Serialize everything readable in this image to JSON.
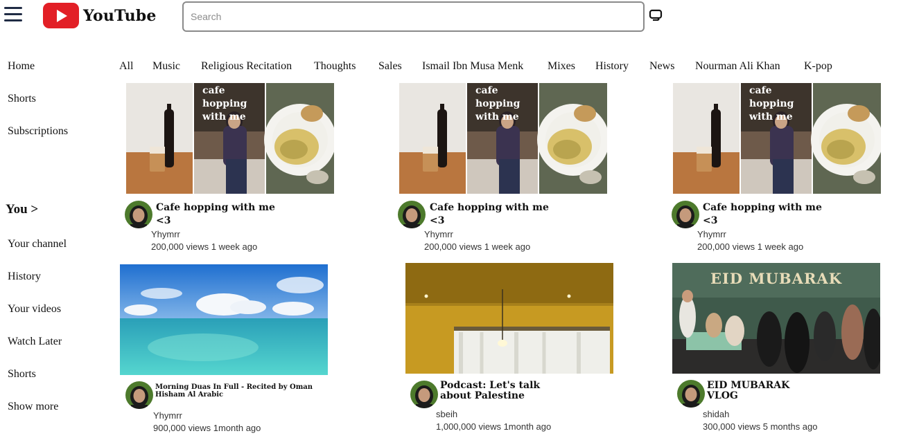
{
  "header": {
    "logo_text": "YouTube",
    "search_placeholder": "Search"
  },
  "sidebar": {
    "top": [
      "Home",
      "Shorts",
      "Subscriptions"
    ],
    "you_label": "You >",
    "you_items": [
      "Your channel",
      "History",
      "Your videos",
      "Watch Later",
      "Shorts",
      "Show more"
    ]
  },
  "chips": [
    "All",
    "Music",
    "Religious Recitation",
    "Thoughts",
    "Sales",
    "Ismail Ibn Musa Menk",
    "Mixes",
    "History",
    "News",
    "Nourman Ali Khan",
    "K-pop"
  ],
  "videos": [
    {
      "title": "Cafe hopping with me <3",
      "channel": "Yhymrr",
      "meta": "200,000 views 1 week ago",
      "thumb_text": "cafe hopping with me"
    },
    {
      "title": "Cafe hopping with me <3",
      "channel": "Yhymrr",
      "meta": "200,000 views 1 week ago",
      "thumb_text": "cafe hopping with me"
    },
    {
      "title": "Cafe hopping with me <3",
      "channel": "Yhymrr",
      "meta": "200,000 views 1 week ago",
      "thumb_text": "cafe hopping with me"
    },
    {
      "title": "Morning Duas In Full - Recited by Oman Hisham Al Arabic",
      "channel": "Yhymrr",
      "meta": "900,000 views 1month ago"
    },
    {
      "title": "Podcast: Let's talk about Palestine",
      "channel": "sbeih",
      "meta": "1,000,000 views 1month ago"
    },
    {
      "title": "EID MUBARAK VLOG",
      "channel": "shidah",
      "meta": "300,000 views 5 months ago",
      "thumb_text": "EID MUBARAK"
    }
  ],
  "colors": {
    "logo_red": "#e21f26",
    "menu_icon": "#1f2b44"
  }
}
